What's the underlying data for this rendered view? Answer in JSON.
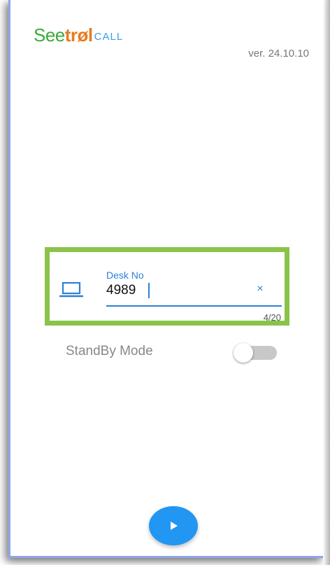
{
  "app": {
    "logo_see": "See",
    "logo_trol": "trøl",
    "logo_call": "CALL",
    "version": "ver. 24.10.10"
  },
  "desk": {
    "label": "Desk No",
    "value": "4989",
    "clear_label": "×",
    "counter": "4/20",
    "icon": "laptop-icon"
  },
  "standby": {
    "label": "StandBy Mode",
    "enabled": false
  },
  "actions": {
    "start_icon": "play-icon"
  },
  "colors": {
    "accent": "#2196f3",
    "highlight": "#8bc34a",
    "logo_green": "#3aaa3a",
    "logo_orange": "#e57c1e"
  }
}
